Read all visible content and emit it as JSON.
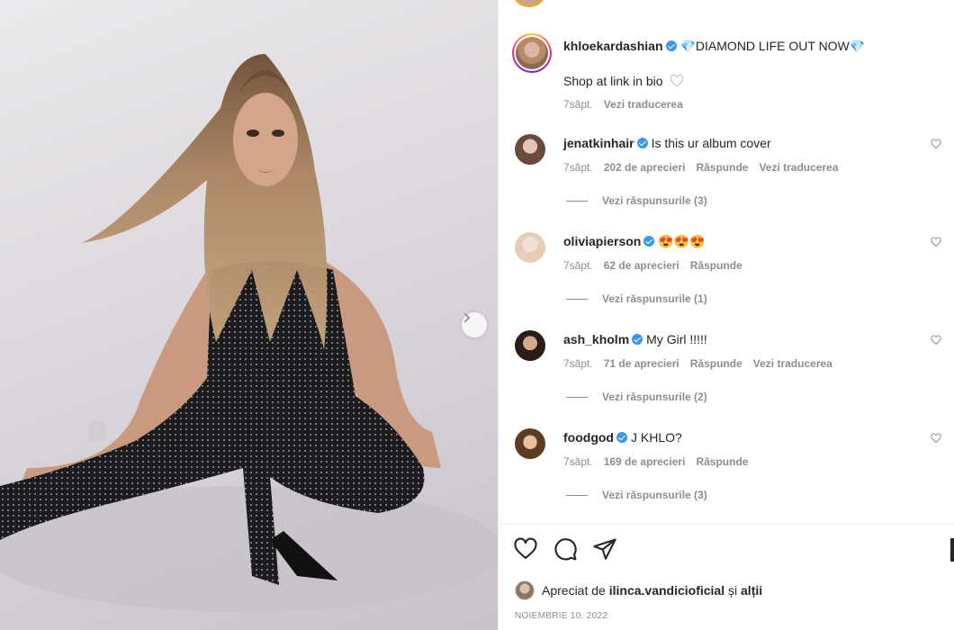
{
  "post": {
    "author": "khloekardashian",
    "caption": "💎DIAMOND LIFE OUT NOW💎",
    "caption_line2": "Shop at link in bio",
    "time": "7săpt.",
    "translate": "Vezi traducerea"
  },
  "comments": [
    {
      "username": "jenatkinhair",
      "text": "Is this ur album cover",
      "time": "7săpt.",
      "likes": "202 de aprecieri",
      "reply": "Răspunde",
      "translate": "Vezi traducerea",
      "view_replies": "Vezi răspunsurile (3)"
    },
    {
      "username": "oliviapierson",
      "text": "😍😍😍",
      "time": "7săpt.",
      "likes": "62 de aprecieri",
      "reply": "Răspunde",
      "translate": "",
      "view_replies": "Vezi răspunsurile (1)"
    },
    {
      "username": "ash_kholm",
      "text": "My Girl !!!!!",
      "time": "7săpt.",
      "likes": "71 de aprecieri",
      "reply": "Răspunde",
      "translate": "Vezi traducerea",
      "view_replies": "Vezi răspunsurile (2)"
    },
    {
      "username": "foodgod",
      "text": "J KHLO?",
      "time": "7săpt.",
      "likes": "169 de aprecieri",
      "reply": "Răspunde",
      "translate": "",
      "view_replies": "Vezi răspunsurile (3)"
    }
  ],
  "likes": {
    "prefix": "Apreciat de",
    "user": "ilinca.vandicioficial",
    "connector": "și",
    "others": "alții"
  },
  "date": "NOIEMBRIE 10, 2022",
  "colors": {
    "verified": "#3897f0",
    "text": "#262626",
    "secondary": "#8e8e8e"
  },
  "icons": {
    "like": "heart-icon",
    "comment": "comment-icon",
    "share": "share-icon",
    "next": "chevron-right-icon"
  }
}
